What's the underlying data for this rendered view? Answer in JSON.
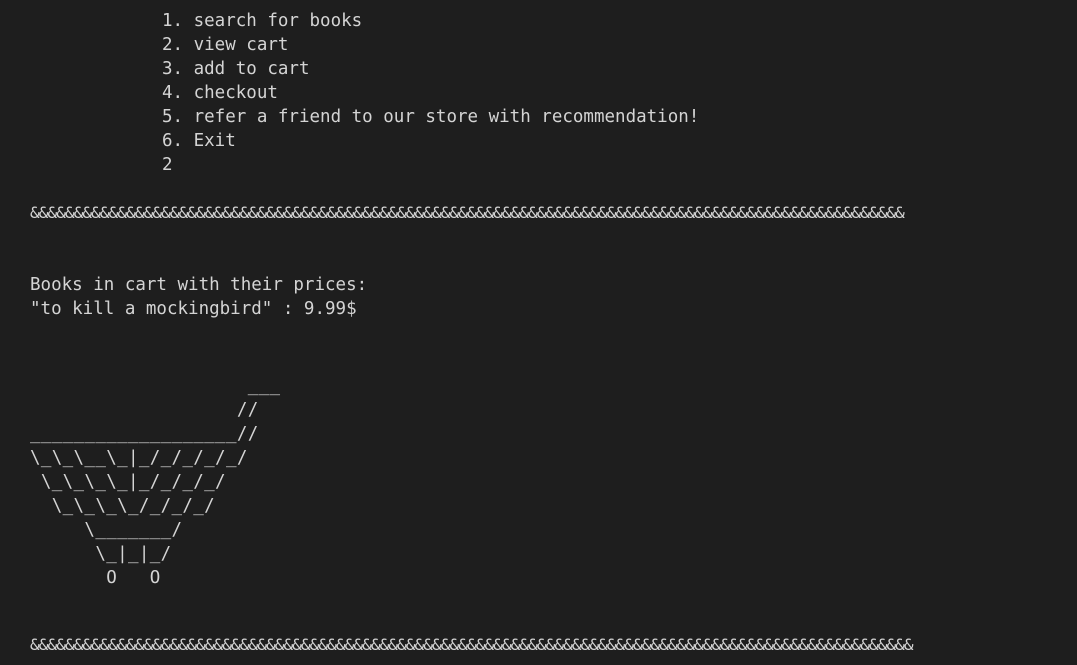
{
  "menu": {
    "items": [
      "1. search for books",
      "2. view cart",
      "3. add to cart",
      "4. checkout",
      "5. refer a friend to our store with recommendation!",
      "6. Exit"
    ],
    "user_input": "2"
  },
  "separator_top": "&&&&&&&&&&&&&&&&&&&&&&&&&&&&&&&&&&&&&&&&&&&&&&&&&&&&&&&&&&&&&&&&&&&&&&&&&&&&&&&&&&&&&&&&&&&&&&&&&&&&",
  "cart": {
    "heading": "Books in cart with their prices:",
    "items": [
      "\"to kill a mockingbird\" : 9.99$"
    ]
  },
  "cart_art": "                    ___\n                   //\n___________________//\n\\_\\_\\__\\_|_/_/_/_/_/\n \\_\\_\\_\\_|_/_/_/_/\n  \\_\\_\\_\\_/_/_/_/\n     \\_______/\n      \\_|_|_/\n       O   O",
  "separator_bottom": "&&&&&&&&&&&&&&&&&&&&&&&&&&&&&&&&&&&&&&&&&&&&&&&&&&&&&&&&&&&&&&&&&&&&&&&&&&&&&&&&&&&&&&&&&&&&&&&&&&&&&",
  "colors": {
    "background": "#1e1e1e",
    "foreground": "#d4d4d4"
  }
}
